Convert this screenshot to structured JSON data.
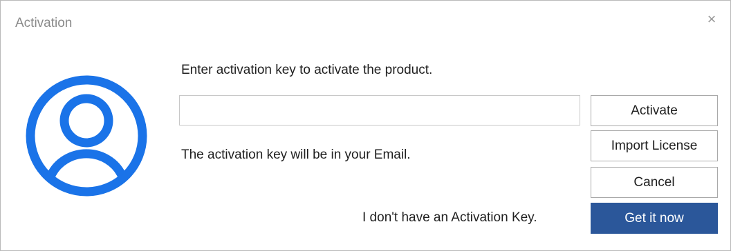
{
  "window": {
    "title": "Activation",
    "close_glyph": "×"
  },
  "avatar": {
    "icon": "user-circle-icon",
    "color": "#1a73e8"
  },
  "main": {
    "prompt": "Enter activation key to activate the product.",
    "key_input_value": "",
    "key_input_placeholder": "",
    "hint": "The activation key will be in your Email.",
    "no_key_text": "I don't have an Activation Key."
  },
  "buttons": {
    "activate": "Activate",
    "import_license": "Import License",
    "cancel": "Cancel",
    "get_it_now": "Get it now"
  },
  "colors": {
    "primary_button": "#2b579a",
    "title_text": "#8a8a8a"
  }
}
